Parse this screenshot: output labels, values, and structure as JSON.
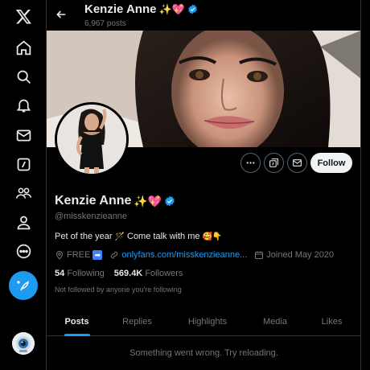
{
  "header": {
    "display_name": "Kenzie Anne",
    "name_emojis": "✨💖",
    "posts_count": "6,967 posts"
  },
  "profile": {
    "display_name": "Kenzie Anne",
    "name_emojis": "✨💖",
    "handle": "@misskenzieanne",
    "bio": "Pet of the year",
    "bio_emoji_1": "🪄",
    "bio_text_2": "Come talk with me",
    "bio_emoji_2": "🥰👇",
    "location": "FREE",
    "location_emoji": "➡",
    "website": "onlyfans.com/misskenzieanne...",
    "joined": "Joined May 2020",
    "following_count": "54",
    "following_label": "Following",
    "followers_count": "569.4K",
    "followers_label": "Followers",
    "not_followed_text": "Not followed by anyone you're following",
    "follow_label": "Follow"
  },
  "tabs": [
    {
      "label": "Posts",
      "active": true
    },
    {
      "label": "Replies",
      "active": false
    },
    {
      "label": "Highlights",
      "active": false
    },
    {
      "label": "Media",
      "active": false
    },
    {
      "label": "Likes",
      "active": false
    }
  ],
  "feed": {
    "error_text": "Something went wrong. Try reloading."
  },
  "nav": {
    "items": [
      "x-logo-icon",
      "home-icon",
      "search-icon",
      "notifications-icon",
      "messages-icon",
      "grok-icon",
      "communities-icon",
      "profile-icon",
      "more-icon"
    ]
  },
  "colors": {
    "accent": "#1d9bf0",
    "background": "#000000",
    "muted": "#71767b",
    "text": "#e7e9ea",
    "verified": "#1d9bf0"
  }
}
